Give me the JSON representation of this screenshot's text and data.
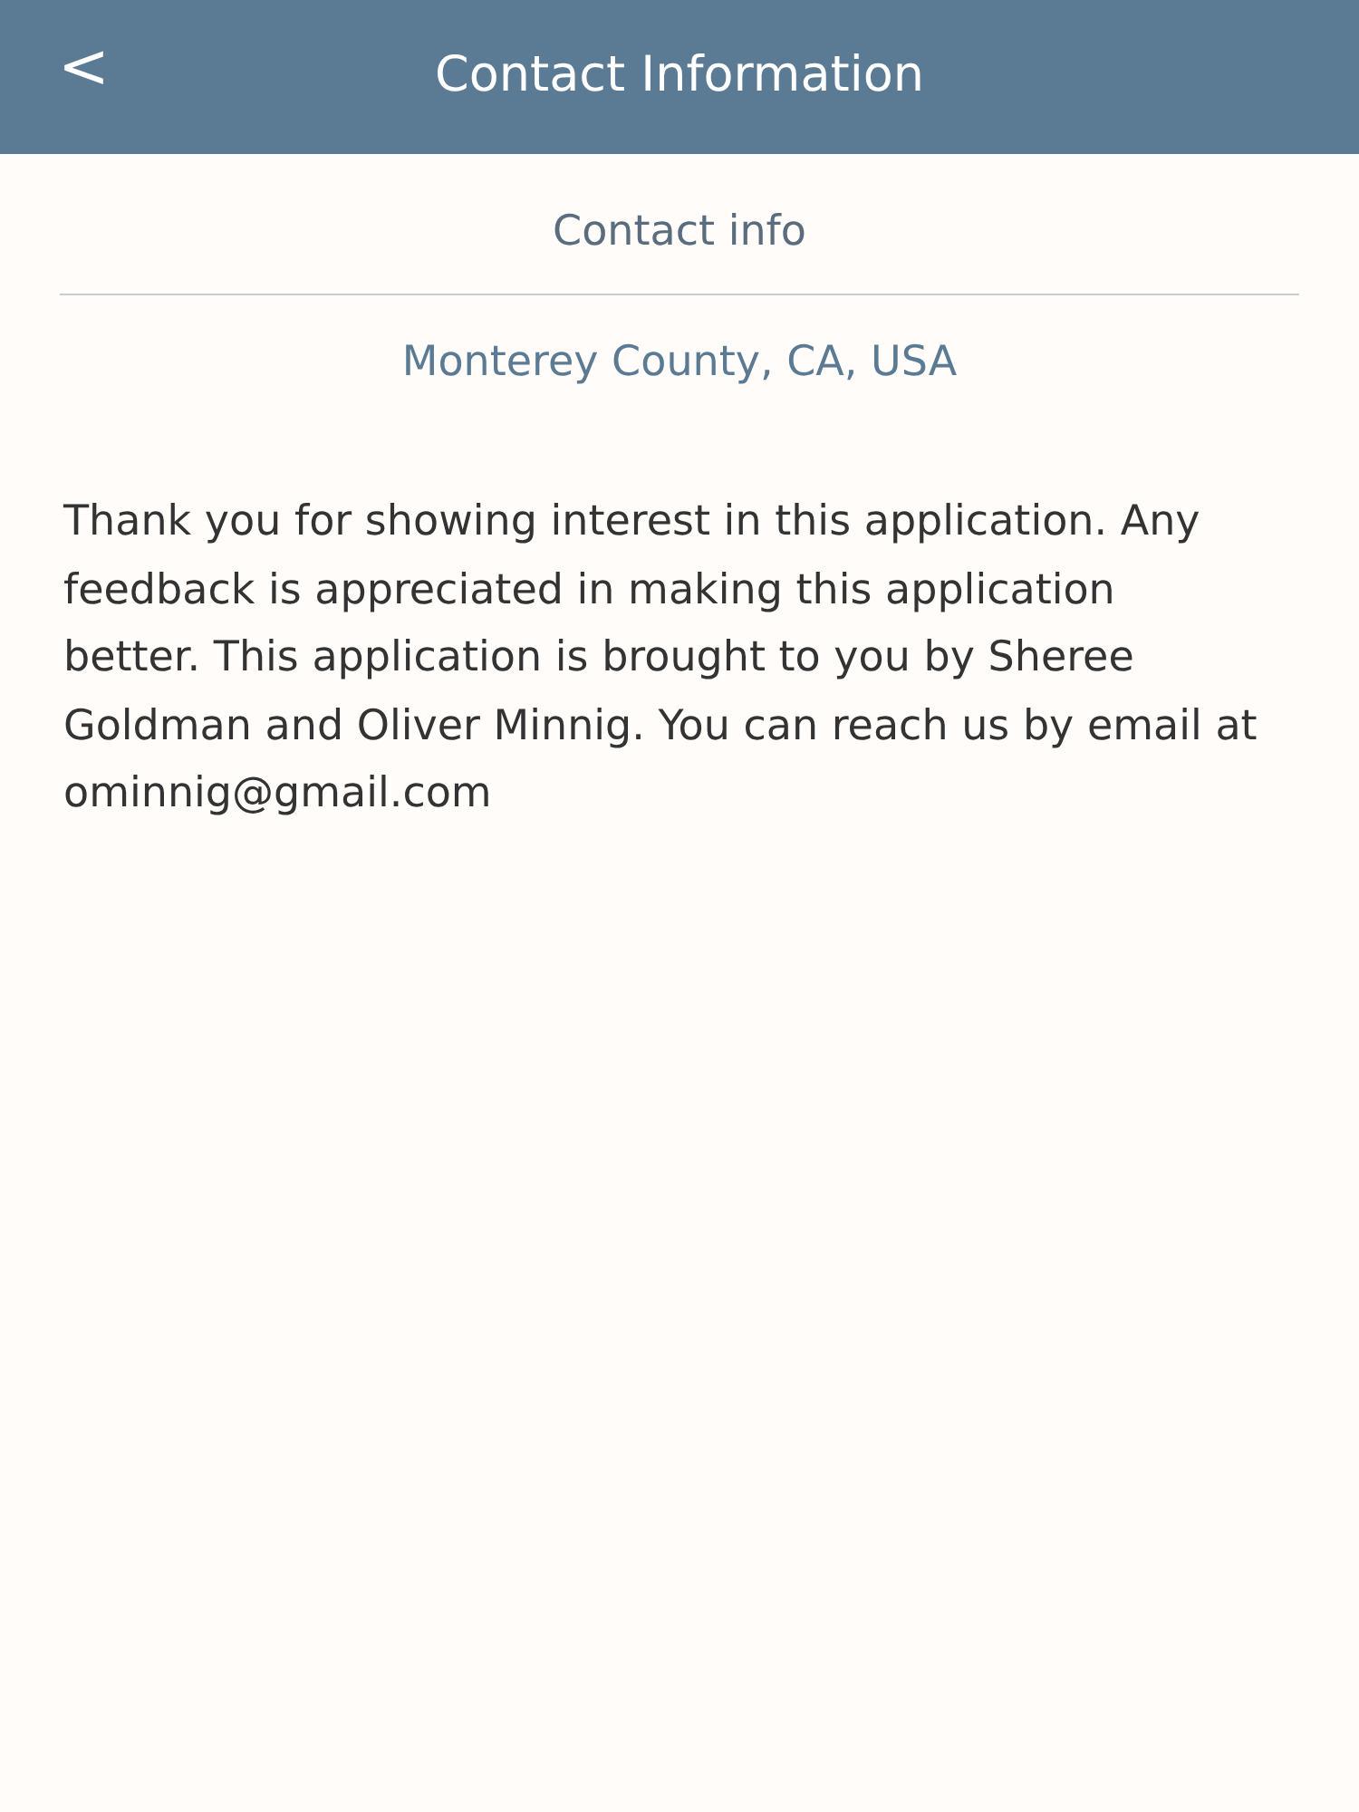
{
  "header": {
    "back": "<",
    "title": "Contact Information"
  },
  "section_title": "Contact info",
  "location": "Monterey County, CA, USA",
  "message": "Thank you for showing interest in this application. Any feedback is appreciated in making this application better. This application is brought to you by Sheree Goldman and Oliver Minnig. You can reach us by email at ominnig@gmail.com"
}
